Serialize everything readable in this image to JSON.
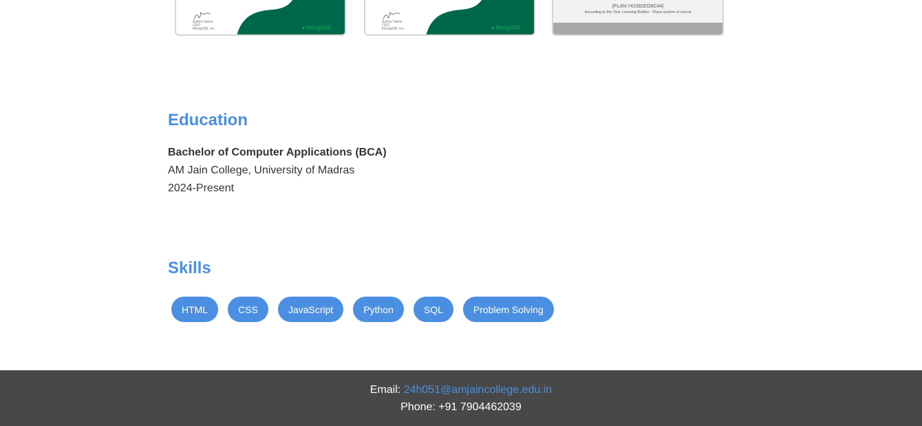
{
  "certificates": [
    {
      "kind": "mongodb",
      "logo_text": "MongoDB"
    },
    {
      "kind": "mongodb",
      "logo_text": "MongoDB"
    },
    {
      "kind": "plan",
      "plan_id": "(PLAN-741582ED6C44)",
      "note": "According to the Your Learning Builder - Plans system of record"
    }
  ],
  "education": {
    "title": "Education",
    "degree": "Bachelor of Computer Applications (BCA)",
    "institution": "AM Jain College, University of Madras",
    "years": "2024-Present"
  },
  "skills": {
    "title": "Skills",
    "items": [
      "HTML",
      "CSS",
      "JavaScript",
      "Python",
      "SQL",
      "Problem Solving"
    ],
    "color": "#4a8fe2"
  },
  "footer": {
    "email_label": "Email:",
    "email": "24h051@amjaincollege.edu.in",
    "phone": "Phone: +91 7904462039",
    "background": "#484848"
  }
}
